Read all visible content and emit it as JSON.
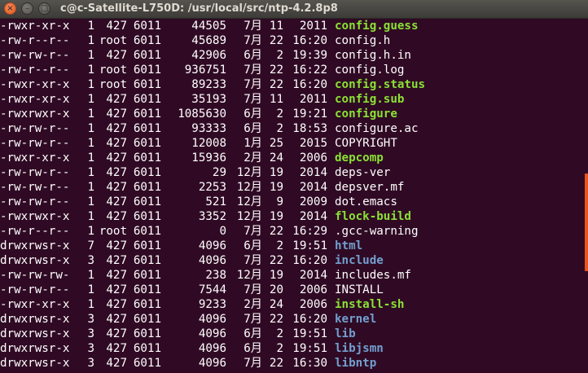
{
  "window": {
    "title": "c@c-Satellite-L750D: /usr/local/src/ntp-4.2.8p8",
    "close_glyph": "×",
    "min_glyph": "–",
    "max_glyph": "□"
  },
  "listing": [
    {
      "perm": "-rwxr-xr-x",
      "links": "1",
      "owner": "427",
      "group": "6011",
      "size": "44505",
      "month": "7月",
      "day": "11",
      "time": "2011",
      "name": "config.guess",
      "type": "exec"
    },
    {
      "perm": "-rw-r--r--",
      "links": "1",
      "owner": "root",
      "group": "6011",
      "size": "45689",
      "month": "7月",
      "day": "22",
      "time": "16:20",
      "name": "config.h",
      "type": "file"
    },
    {
      "perm": "-rw-rw-r--",
      "links": "1",
      "owner": "427",
      "group": "6011",
      "size": "42906",
      "month": "6月",
      "day": "2",
      "time": "19:39",
      "name": "config.h.in",
      "type": "file"
    },
    {
      "perm": "-rw-r--r--",
      "links": "1",
      "owner": "root",
      "group": "6011",
      "size": "936751",
      "month": "7月",
      "day": "22",
      "time": "16:22",
      "name": "config.log",
      "type": "file"
    },
    {
      "perm": "-rwxr-xr-x",
      "links": "1",
      "owner": "root",
      "group": "6011",
      "size": "89233",
      "month": "7月",
      "day": "22",
      "time": "16:20",
      "name": "config.status",
      "type": "exec"
    },
    {
      "perm": "-rwxr-xr-x",
      "links": "1",
      "owner": "427",
      "group": "6011",
      "size": "35193",
      "month": "7月",
      "day": "11",
      "time": "2011",
      "name": "config.sub",
      "type": "exec"
    },
    {
      "perm": "-rwxrwxr-x",
      "links": "1",
      "owner": "427",
      "group": "6011",
      "size": "1085630",
      "month": "6月",
      "day": "2",
      "time": "19:21",
      "name": "configure",
      "type": "exec"
    },
    {
      "perm": "-rw-rw-r--",
      "links": "1",
      "owner": "427",
      "group": "6011",
      "size": "93333",
      "month": "6月",
      "day": "2",
      "time": "18:53",
      "name": "configure.ac",
      "type": "file"
    },
    {
      "perm": "-rw-rw-r--",
      "links": "1",
      "owner": "427",
      "group": "6011",
      "size": "12008",
      "month": "1月",
      "day": "25",
      "time": "2015",
      "name": "COPYRIGHT",
      "type": "file"
    },
    {
      "perm": "-rwxr-xr-x",
      "links": "1",
      "owner": "427",
      "group": "6011",
      "size": "15936",
      "month": "2月",
      "day": "24",
      "time": "2006",
      "name": "depcomp",
      "type": "exec"
    },
    {
      "perm": "-rw-rw-r--",
      "links": "1",
      "owner": "427",
      "group": "6011",
      "size": "29",
      "month": "12月",
      "day": "19",
      "time": "2014",
      "name": "deps-ver",
      "type": "file"
    },
    {
      "perm": "-rw-rw-r--",
      "links": "1",
      "owner": "427",
      "group": "6011",
      "size": "2253",
      "month": "12月",
      "day": "19",
      "time": "2014",
      "name": "depsver.mf",
      "type": "file"
    },
    {
      "perm": "-rw-rw-r--",
      "links": "1",
      "owner": "427",
      "group": "6011",
      "size": "521",
      "month": "12月",
      "day": "9",
      "time": "2009",
      "name": "dot.emacs",
      "type": "file"
    },
    {
      "perm": "-rwxrwxr-x",
      "links": "1",
      "owner": "427",
      "group": "6011",
      "size": "3352",
      "month": "12月",
      "day": "19",
      "time": "2014",
      "name": "flock-build",
      "type": "exec"
    },
    {
      "perm": "-rw-r--r--",
      "links": "1",
      "owner": "root",
      "group": "6011",
      "size": "0",
      "month": "7月",
      "day": "22",
      "time": "16:29",
      "name": ".gcc-warning",
      "type": "file"
    },
    {
      "perm": "drwxrwsr-x",
      "links": "7",
      "owner": "427",
      "group": "6011",
      "size": "4096",
      "month": "6月",
      "day": "2",
      "time": "19:51",
      "name": "html",
      "type": "dir"
    },
    {
      "perm": "drwxrwsr-x",
      "links": "3",
      "owner": "427",
      "group": "6011",
      "size": "4096",
      "month": "7月",
      "day": "22",
      "time": "16:20",
      "name": "include",
      "type": "dir"
    },
    {
      "perm": "-rw-rw-rw-",
      "links": "1",
      "owner": "427",
      "group": "6011",
      "size": "238",
      "month": "12月",
      "day": "19",
      "time": "2014",
      "name": "includes.mf",
      "type": "file"
    },
    {
      "perm": "-rw-rw-r--",
      "links": "1",
      "owner": "427",
      "group": "6011",
      "size": "7544",
      "month": "7月",
      "day": "20",
      "time": "2006",
      "name": "INSTALL",
      "type": "file"
    },
    {
      "perm": "-rwxr-xr-x",
      "links": "1",
      "owner": "427",
      "group": "6011",
      "size": "9233",
      "month": "2月",
      "day": "24",
      "time": "2006",
      "name": "install-sh",
      "type": "exec"
    },
    {
      "perm": "drwxrwsr-x",
      "links": "3",
      "owner": "427",
      "group": "6011",
      "size": "4096",
      "month": "7月",
      "day": "22",
      "time": "16:20",
      "name": "kernel",
      "type": "dir"
    },
    {
      "perm": "drwxrwsr-x",
      "links": "3",
      "owner": "427",
      "group": "6011",
      "size": "4096",
      "month": "6月",
      "day": "2",
      "time": "19:51",
      "name": "lib",
      "type": "dir"
    },
    {
      "perm": "drwxrwsr-x",
      "links": "3",
      "owner": "427",
      "group": "6011",
      "size": "4096",
      "month": "6月",
      "day": "2",
      "time": "19:51",
      "name": "libjsmn",
      "type": "dir"
    },
    {
      "perm": "drwxrwsr-x",
      "links": "3",
      "owner": "427",
      "group": "6011",
      "size": "4096",
      "month": "7月",
      "day": "22",
      "time": "16:30",
      "name": "libntp",
      "type": "dir"
    }
  ],
  "colors": {
    "background": "#300a24",
    "text": "#ffffff",
    "exec": "#8ae234",
    "dir": "#729fcf",
    "scrollbar_thumb": "#e95420"
  }
}
